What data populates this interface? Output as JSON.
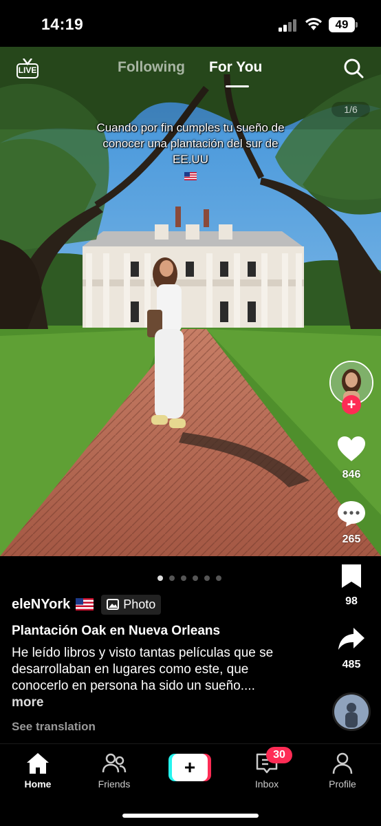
{
  "status_bar": {
    "time": "14:19",
    "battery": "49"
  },
  "top_nav": {
    "live_label": "LIVE",
    "following": "Following",
    "for_you": "For You"
  },
  "post": {
    "page_counter": "1/6",
    "overlay_caption": "Cuando por fin cumples tu sueño de conocer una plantación del sur de EE.UU",
    "author": "eleNYork",
    "media_badge": "Photo",
    "title": "Plantación Oak en Nueva Orleans",
    "description": "He leído libros y visto tantas películas que se desarrollaban en lugares como este, que conocerlo en persona ha sido un sueño....",
    "more_label": "more",
    "see_translation": "See translation",
    "total_slides": 6,
    "active_slide": 1
  },
  "actions": {
    "likes": "846",
    "comments": "265",
    "saves": "98",
    "shares": "485"
  },
  "bottom_nav": {
    "home": "Home",
    "friends": "Friends",
    "inbox": "Inbox",
    "inbox_badge": "30",
    "profile": "Profile"
  },
  "colors": {
    "accent_red": "#fe2c55",
    "accent_cyan": "#25f4ee",
    "background": "#000000"
  },
  "icons": [
    "live-icon",
    "search-icon",
    "heart-icon",
    "comment-icon",
    "bookmark-icon",
    "share-icon",
    "home-icon",
    "friends-icon",
    "create-icon",
    "inbox-icon",
    "profile-icon",
    "photo-icon",
    "us-flag-icon"
  ]
}
